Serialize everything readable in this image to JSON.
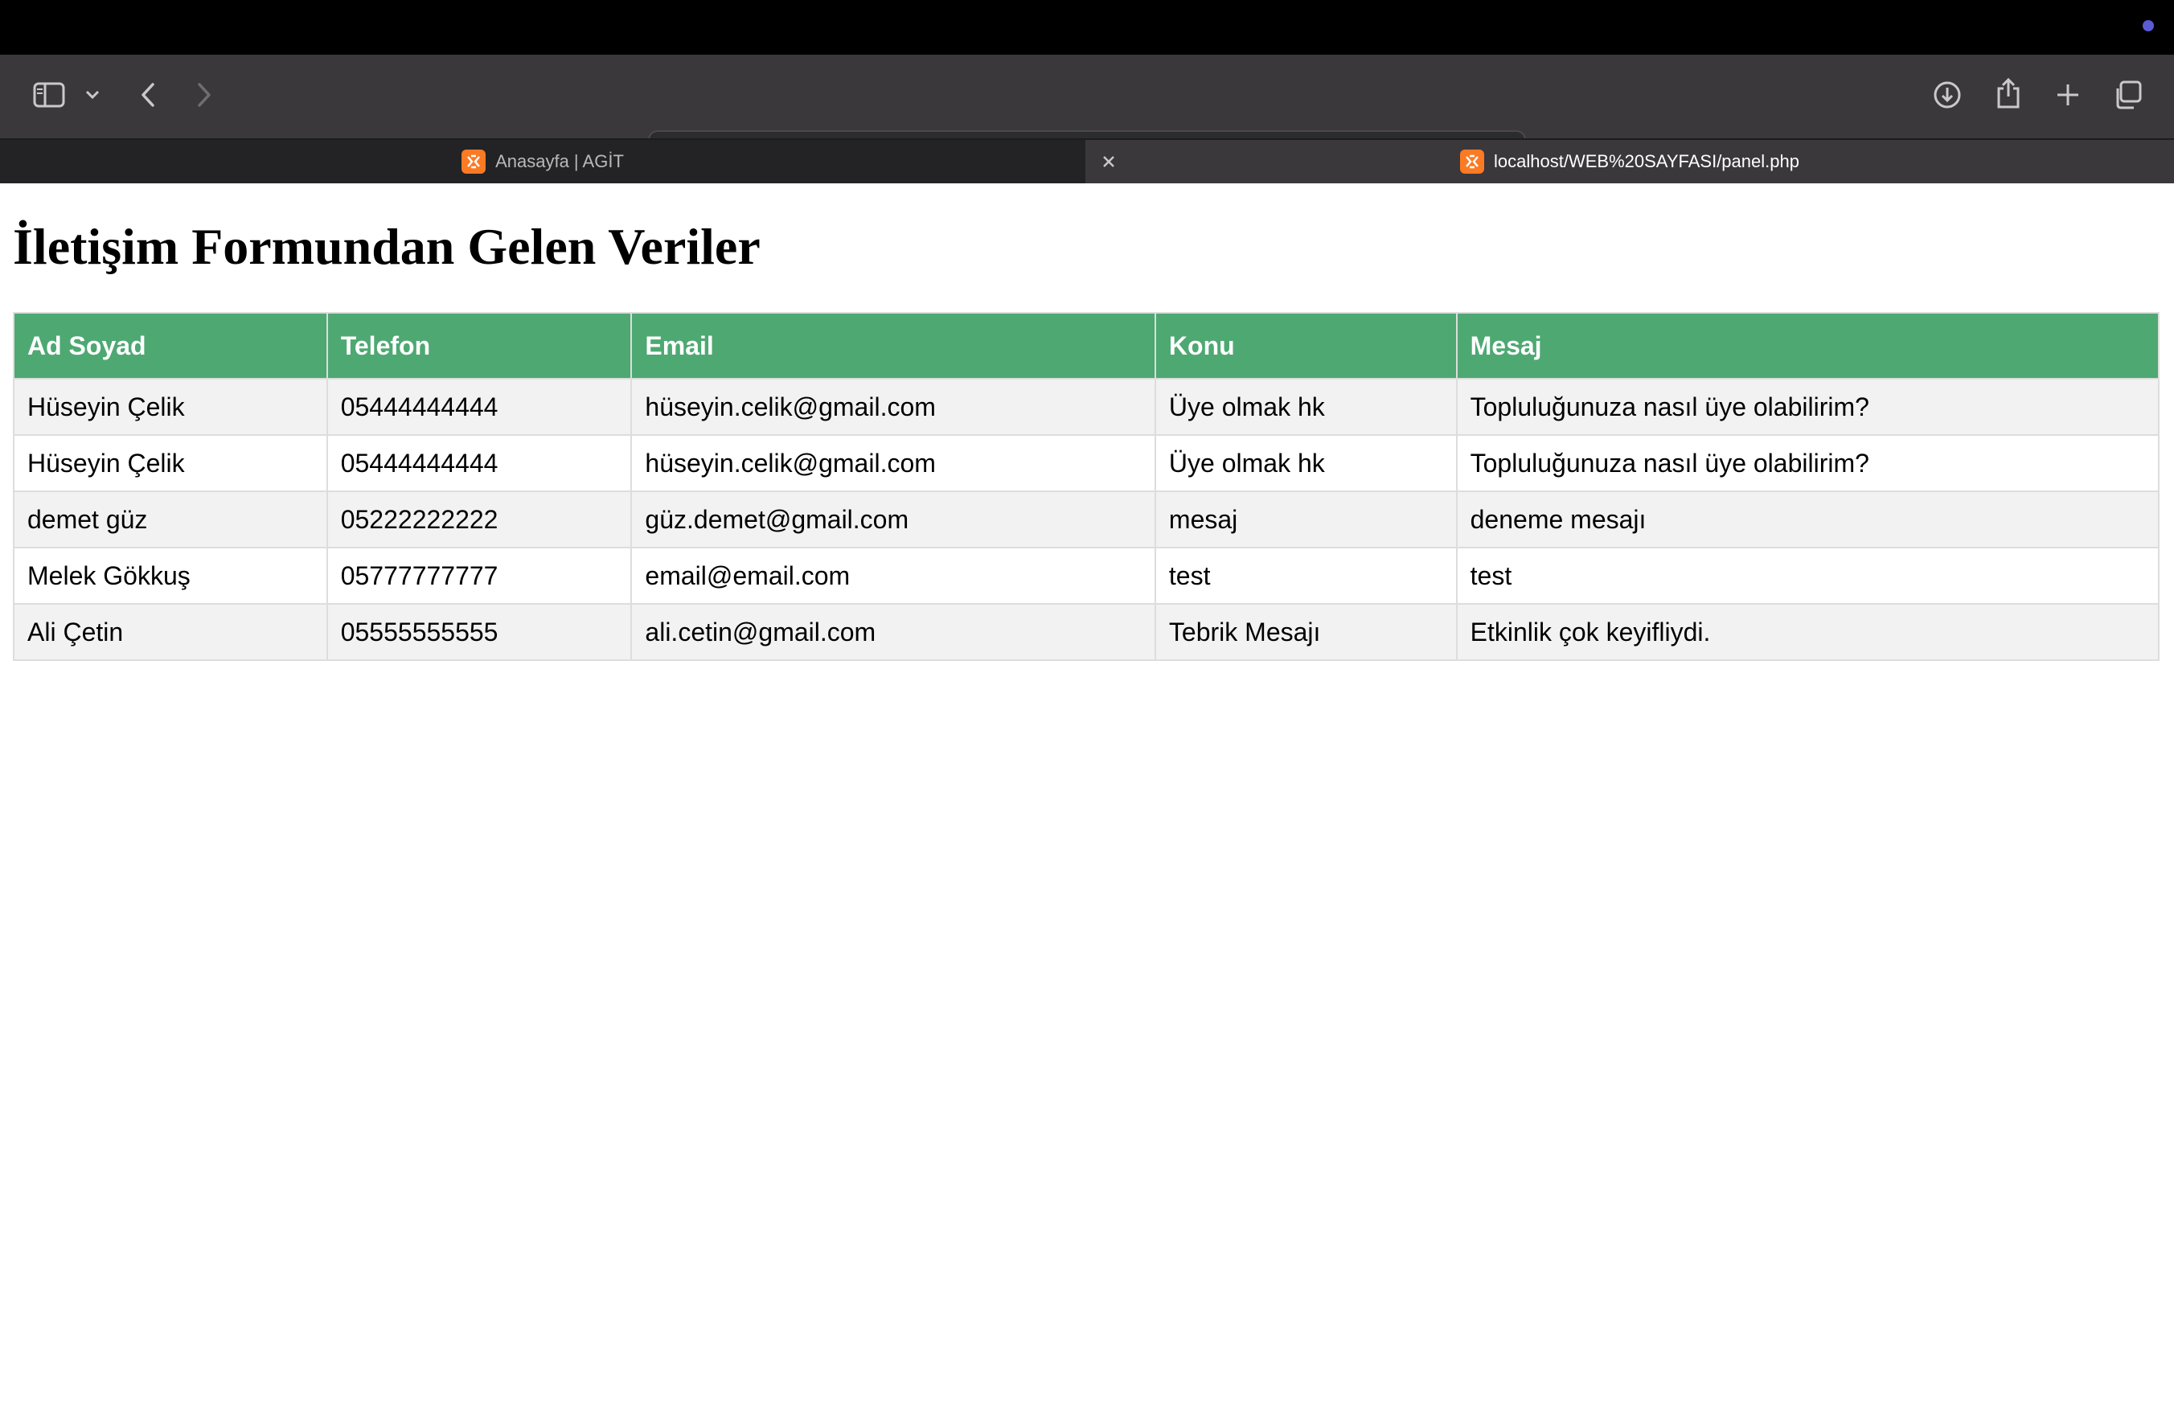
{
  "browser": {
    "url": "localhost",
    "tabs": [
      {
        "title": "Anasayfa | AGİT",
        "active": false
      },
      {
        "title": "localhost/WEB%20SAYFASI/panel.php",
        "active": true
      }
    ],
    "icons": [
      "sidebar-icon",
      "chevron-down-icon",
      "back-icon",
      "forward-icon",
      "site-settings-icon",
      "reload-icon",
      "download-icon",
      "share-icon",
      "new-tab-icon",
      "tab-overview-icon",
      "close-icon",
      "xampp-favicon-icon"
    ],
    "colors": {
      "accent": "#4ea872",
      "menubar_dot": "#5b5bd6",
      "favicon": "#fb7a24"
    }
  },
  "page": {
    "title": "İletişim Formundan Gelen Veriler",
    "table": {
      "headers": [
        "Ad Soyad",
        "Telefon",
        "Email",
        "Konu",
        "Mesaj"
      ],
      "rows": [
        [
          "Hüseyin Çelik",
          "05444444444",
          "hüseyin.celik@gmail.com",
          "Üye olmak hk",
          "Topluluğunuza nasıl üye olabilirim?"
        ],
        [
          "Hüseyin Çelik",
          "05444444444",
          "hüseyin.celik@gmail.com",
          "Üye olmak hk",
          "Topluluğunuza nasıl üye olabilirim?"
        ],
        [
          "demet güz",
          "05222222222",
          "güz.demet@gmail.com",
          "mesaj",
          "deneme mesajı"
        ],
        [
          "Melek Gökkuş",
          "05777777777",
          "email@email.com",
          "test",
          "test"
        ],
        [
          "Ali Çetin",
          "05555555555",
          "ali.cetin@gmail.com",
          "Tebrik Mesajı",
          "Etkinlik çok keyifliydi."
        ]
      ]
    }
  }
}
